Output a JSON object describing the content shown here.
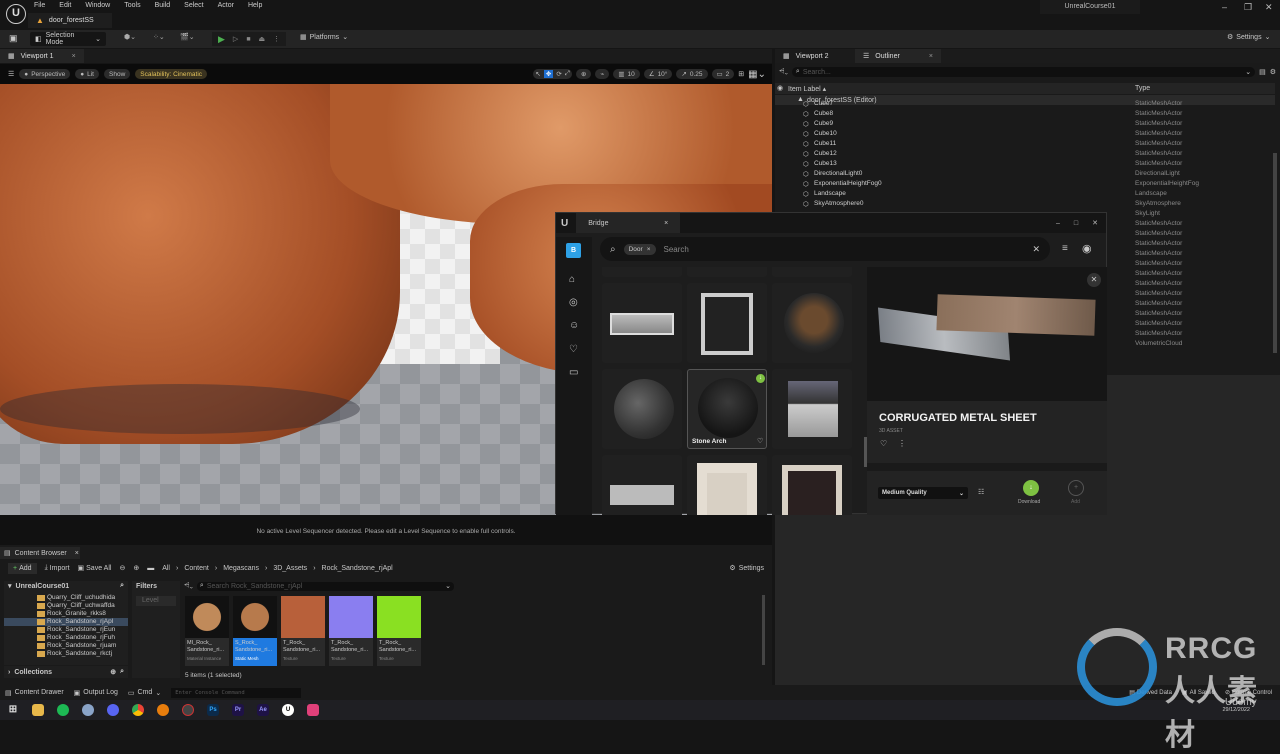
{
  "menu": {
    "items": [
      "File",
      "Edit",
      "Window",
      "Tools",
      "Build",
      "Select",
      "Actor",
      "Help"
    ],
    "level_tab": "door_forestSS",
    "project": "UnrealCourse01"
  },
  "toolbar": {
    "selection_mode": "Selection Mode",
    "platforms": "Platforms",
    "settings": "Settings"
  },
  "viewport": {
    "tab": "Viewport 1",
    "perspective": "Perspective",
    "lit": "Lit",
    "show": "Show",
    "scalability": "Scalability: Cinematic",
    "grid": "10",
    "angle": "10°",
    "scale": "0.25",
    "camera_speed": "2",
    "sequencer_msg": "No active Level Sequencer detected. Please edit a Level Sequence to enable full controls."
  },
  "outliner": {
    "tabs": [
      "Viewport 2",
      "Outliner"
    ],
    "search_placeholder": "Search...",
    "col_label": "Item Label ▴",
    "col_type": "Type",
    "root": "door_forestSS (Editor)",
    "rows": [
      {
        "name": "Cube7",
        "type": "StaticMeshActor"
      },
      {
        "name": "Cube8",
        "type": "StaticMeshActor"
      },
      {
        "name": "Cube9",
        "type": "StaticMeshActor"
      },
      {
        "name": "Cube10",
        "type": "StaticMeshActor"
      },
      {
        "name": "Cube11",
        "type": "StaticMeshActor"
      },
      {
        "name": "Cube12",
        "type": "StaticMeshActor"
      },
      {
        "name": "Cube13",
        "type": "StaticMeshActor"
      },
      {
        "name": "DirectionalLight0",
        "type": "DirectionalLight"
      },
      {
        "name": "ExponentialHeightFog0",
        "type": "ExponentialHeightFog"
      },
      {
        "name": "Landscape",
        "type": "Landscape"
      },
      {
        "name": "SkyAtmosphere0",
        "type": "SkyAtmosphere"
      },
      {
        "name": "",
        "type": "SkyLight"
      },
      {
        "name": "",
        "type": "StaticMeshActor"
      },
      {
        "name": "",
        "type": "StaticMeshActor"
      },
      {
        "name": "",
        "type": "StaticMeshActor"
      },
      {
        "name": "",
        "type": "StaticMeshActor"
      },
      {
        "name": "",
        "type": "StaticMeshActor"
      },
      {
        "name": "",
        "type": "StaticMeshActor"
      },
      {
        "name": "",
        "type": "StaticMeshActor"
      },
      {
        "name": "",
        "type": "StaticMeshActor"
      },
      {
        "name": "",
        "type": "StaticMeshActor"
      },
      {
        "name": "",
        "type": "StaticMeshActor"
      },
      {
        "name": "",
        "type": "StaticMeshActor"
      },
      {
        "name": "",
        "type": "StaticMeshActor"
      },
      {
        "name": "",
        "type": "VolumetricCloud"
      }
    ]
  },
  "bridge": {
    "title": "Bridge",
    "filter_chip": "Door",
    "search_placeholder": "Search",
    "hover_card": "Stone Arch",
    "asset_title": "CORRUGATED METAL SHEET",
    "asset_kind": "3D ASSET",
    "quality": "Medium Quality",
    "download": "Download",
    "add": "Add",
    "accent": "#7ec142"
  },
  "content_browser": {
    "tab": "Content Browser",
    "add": "Add",
    "import": "Import",
    "save_all": "Save All",
    "settings": "Settings",
    "breadcrumb": [
      "All",
      "Content",
      "Megascans",
      "3D_Assets",
      "Rock_Sandstone_rjApl"
    ],
    "tree_root": "UnrealCourse01",
    "folders": [
      "Quarry_Cliff_uchudhida",
      "Quarry_Cliff_uchwaffda",
      "Rock_Granite_rkks8",
      "Rock_Sandstone_rjApl",
      "Rock_Sandstone_rjEun",
      "Rock_Sandstone_rjFuh",
      "Rock_Sandstone_rjuam",
      "Rock_Sandstone_rkctj"
    ],
    "selected_folder": "Rock_Sandstone_rjApl",
    "collections": "Collections",
    "filters": "Filters",
    "filter_level": "Level",
    "search_placeholder": "Search Rock_Sandstone_rjApl",
    "assets": [
      {
        "name": "MI_Rock_ Sandstone_ri...",
        "kind": "Material Instance",
        "color": "#c08a5a"
      },
      {
        "name": "S_Rock_ Sandstone_ri...",
        "kind": "Static Mesh",
        "color": "#b77a4c"
      },
      {
        "name": "T_Rock_ Sandstone_ri...",
        "kind": "Texture",
        "color": "#b8603a"
      },
      {
        "name": "T_Rock_ Sandstone_ri...",
        "kind": "Texture",
        "color": "#8a7ef0"
      },
      {
        "name": "T_Rock_ Sandstone_ri...",
        "kind": "Texture",
        "color": "#8ae022"
      }
    ],
    "status": "5 items (1 selected)"
  },
  "bottom": {
    "content_drawer": "Content Drawer",
    "output_log": "Output Log",
    "cmd": "Cmd",
    "console_placeholder": "Enter Console Command",
    "derived_data": "Derived Data",
    "all_saved": "All Saved",
    "source_control": "Source Control"
  },
  "taskbar": {
    "date": "29/12/2022"
  },
  "watermark": {
    "text": "RRCG 人人素材",
    "udemy": "Udemy"
  }
}
